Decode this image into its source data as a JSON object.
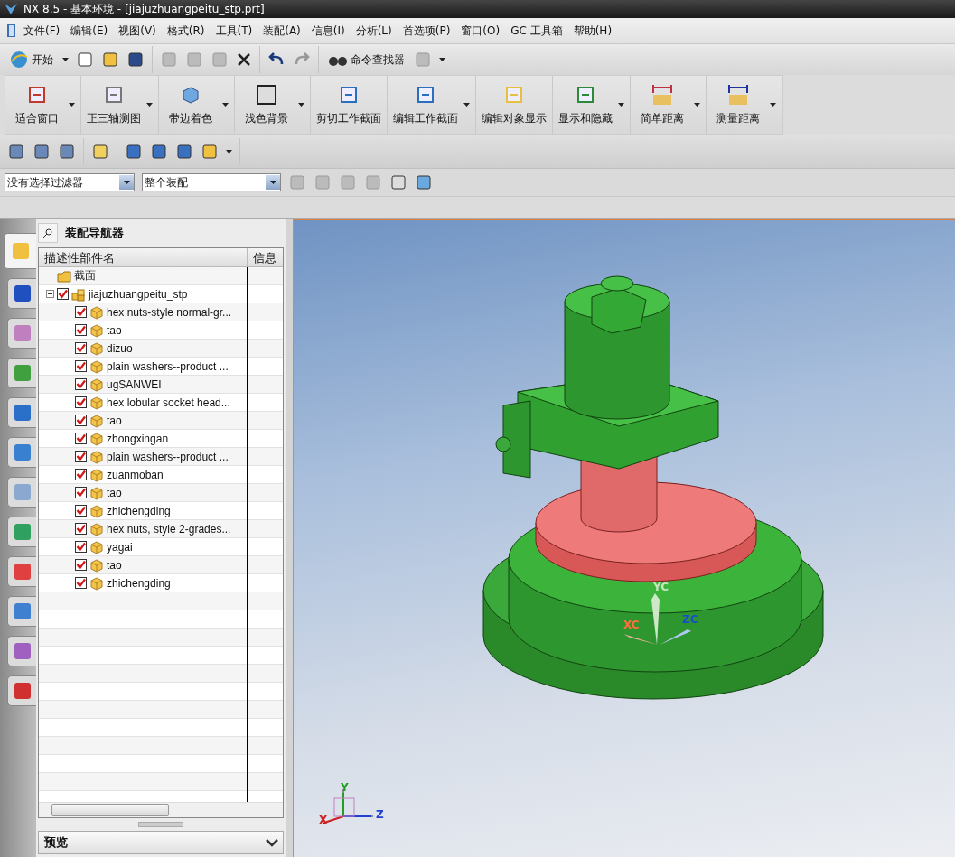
{
  "window": {
    "title": "NX 8.5 - 基本环境 - [jiajuzhuangpeitu_stp.prt]"
  },
  "menu": [
    "文件(F)",
    "编辑(E)",
    "视图(V)",
    "格式(R)",
    "工具(T)",
    "装配(A)",
    "信息(I)",
    "分析(L)",
    "首选项(P)",
    "窗口(O)",
    "GC 工具箱",
    "帮助(H)"
  ],
  "standard_toolbar": {
    "start": "开始",
    "command_finder": "命令查找器"
  },
  "view_toolbar": [
    {
      "label": "适合窗口",
      "dropdown": true
    },
    {
      "label": "正三轴测图",
      "dropdown": true
    },
    {
      "label": "带边着色",
      "dropdown": true
    },
    {
      "label": "浅色背景",
      "dropdown": true
    },
    {
      "label": "剪切工作截面",
      "dropdown": false
    },
    {
      "label": "编辑工作截面",
      "dropdown": true
    },
    {
      "label": "编辑对象显示",
      "dropdown": false
    },
    {
      "label": "显示和隐藏",
      "dropdown": true
    },
    {
      "label": "简单距离",
      "dropdown": true
    },
    {
      "label": "测量距离",
      "dropdown": true
    }
  ],
  "selection_bar": {
    "filter": "没有选择过滤器",
    "scope": "整个装配"
  },
  "resource_tabs": [
    {
      "selected": true
    },
    {
      "selected": false
    },
    {
      "selected": false
    },
    {
      "selected": false
    },
    {
      "selected": false
    },
    {
      "selected": false
    },
    {
      "selected": false
    },
    {
      "selected": false
    },
    {
      "selected": false
    },
    {
      "selected": false
    },
    {
      "selected": false
    },
    {
      "selected": false
    }
  ],
  "navigator": {
    "title": "装配导航器",
    "columns": [
      "描述性部件名",
      "信息"
    ],
    "tree": [
      {
        "label": "截面",
        "kind": "folder"
      },
      {
        "label": "jiajuzhuangpeitu_stp",
        "kind": "assembly",
        "checked": true,
        "expanded": true,
        "children": [
          {
            "label": "hex nuts-style normal-gr...",
            "kind": "part",
            "checked": true
          },
          {
            "label": "tao",
            "kind": "part",
            "checked": true
          },
          {
            "label": "dizuo",
            "kind": "part",
            "checked": true
          },
          {
            "label": "plain washers--product ...",
            "kind": "part",
            "checked": true
          },
          {
            "label": "ugSANWEI",
            "kind": "part",
            "checked": true
          },
          {
            "label": "hex lobular socket head...",
            "kind": "part",
            "checked": true
          },
          {
            "label": "tao",
            "kind": "part",
            "checked": true
          },
          {
            "label": "zhongxingan",
            "kind": "part",
            "checked": true
          },
          {
            "label": "plain washers--product ...",
            "kind": "part",
            "checked": true
          },
          {
            "label": "zuanmoban",
            "kind": "part",
            "checked": true
          },
          {
            "label": "tao",
            "kind": "part",
            "checked": true
          },
          {
            "label": "zhichengding",
            "kind": "part",
            "checked": true
          },
          {
            "label": "hex nuts, style 2-grades...",
            "kind": "part",
            "checked": true
          },
          {
            "label": "yagai",
            "kind": "part",
            "checked": true
          },
          {
            "label": "tao",
            "kind": "part",
            "checked": true
          },
          {
            "label": "zhichengding",
            "kind": "part",
            "checked": true
          }
        ]
      }
    ]
  },
  "preview": {
    "title": "预览"
  },
  "viewport": {
    "wcs_labels": [
      "YC",
      "XC",
      "ZC"
    ],
    "triad_labels": [
      "Y",
      "X",
      "Z"
    ]
  }
}
